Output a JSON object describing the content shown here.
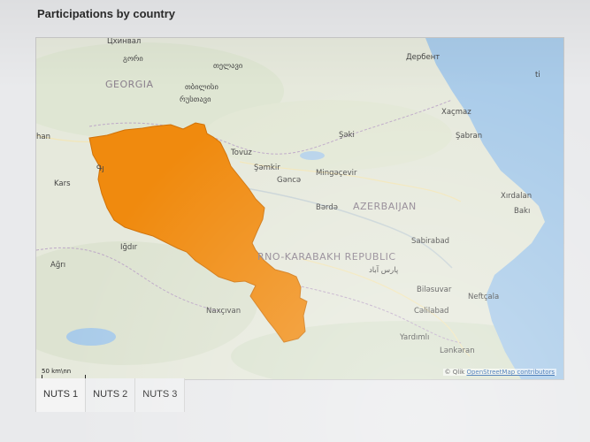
{
  "widget": {
    "title": "Participations by country"
  },
  "map": {
    "highlight_color": "#f08a0e",
    "water_color": "#a9cbe9",
    "labels": {
      "tskhinvali": "Цхинвал",
      "gori": "გორი",
      "telavi": "თელავი",
      "georgia": "GEORGIA",
      "tbilisi": "თბილისი",
      "rustavi": "რუსთავი",
      "derbent": "Дербент",
      "xacmaz": "Xaçmaz",
      "sheki": "Şəki",
      "shabran": "Şabran",
      "tovuz": "Tovuz",
      "shamkir": "Şəmkir",
      "mingachevir": "Mingəçevir",
      "ganja": "Gəncə",
      "kars": "Kars",
      "barda": "Bərdə",
      "azerbaijan": "AZERBAIJAN",
      "xirdalan": "Xırdalan",
      "baku": "Bakı",
      "igdir": "Iğdır",
      "sabirabad": "Sabirabad",
      "nkr": "RNO-KARABAKH REPUBLIC",
      "agri": "Ağrı",
      "parsabad": "پارس آباد",
      "bilesuvar": "Biləsuvar",
      "neftchala": "Neftçala",
      "nakhchivan": "Naxçıvan",
      "celilabad": "Cəlilabad",
      "yardimli": "Yardımlı",
      "lankaran": "Lənkəran",
      "left_edge": "han",
      "gyumri": "Գյ",
      "sea_glyph": "ti"
    },
    "scalebar": {
      "label": "50 km",
      "suffix": "\\nn"
    },
    "attribution": {
      "prefix": "© Qlik",
      "link": "OpenStreetMap contributors"
    }
  },
  "tabs": [
    {
      "label": "NUTS 1"
    },
    {
      "label": "NUTS 2"
    },
    {
      "label": "NUTS 3"
    }
  ]
}
